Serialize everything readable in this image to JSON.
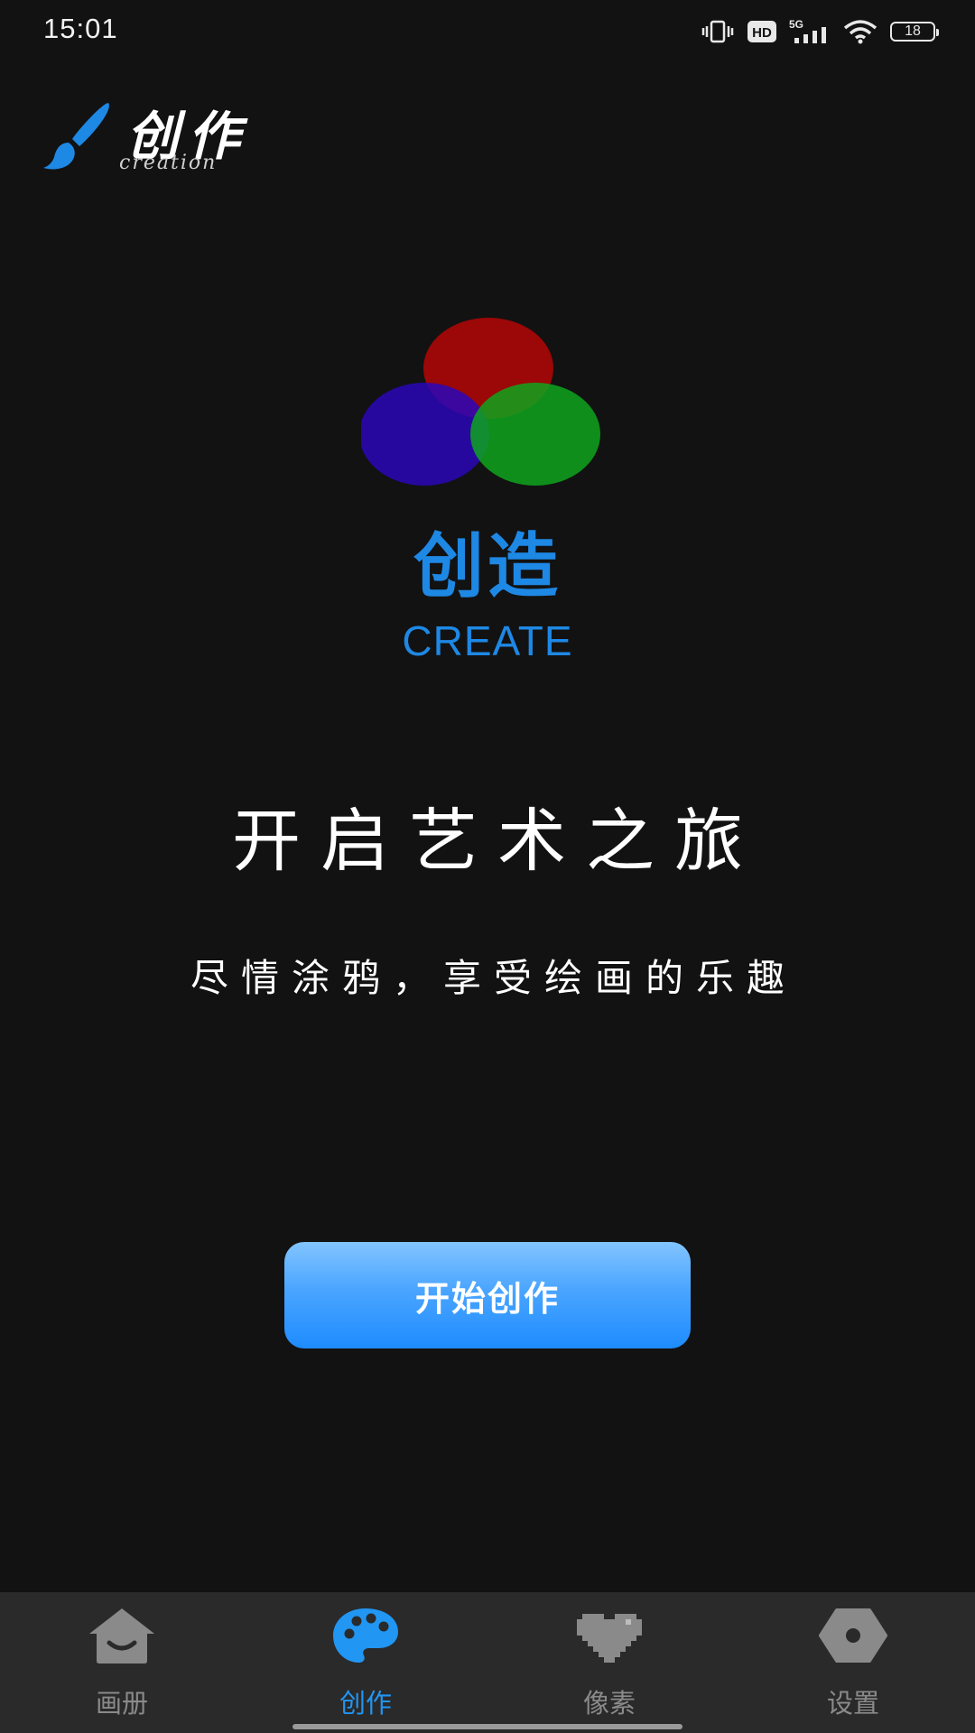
{
  "status_bar": {
    "time": "15:01",
    "network_label": "5G",
    "hd_label": "HD",
    "battery_level": "18",
    "icons": [
      "vibrate-icon",
      "hd-icon",
      "signal-5g-icon",
      "wifi-icon",
      "battery-icon"
    ]
  },
  "header": {
    "logo_title": "创作",
    "logo_subtitle": "creation",
    "logo_icon": "paintbrush-icon"
  },
  "hero": {
    "emblem_icon": "rgb-circles-icon",
    "title": "创造",
    "subtitle": "CREATE"
  },
  "main": {
    "heading": "开启艺术之旅",
    "tagline": "尽情涂鸦，享受绘画的乐趣",
    "start_button_label": "开始创作"
  },
  "bottom_nav": {
    "active_index": 1,
    "items": [
      {
        "label": "画册",
        "icon": "album-house-icon"
      },
      {
        "label": "创作",
        "icon": "palette-icon"
      },
      {
        "label": "像素",
        "icon": "pixel-heart-icon"
      },
      {
        "label": "设置",
        "icon": "settings-hex-icon"
      }
    ]
  },
  "colors": {
    "background": "#121212",
    "accent": "#1e88e5",
    "nav_background": "#2a2a2a",
    "nav_inactive": "#8a8a8a",
    "button_top": "#82c4ff",
    "button_bottom": "#1e8cff"
  }
}
